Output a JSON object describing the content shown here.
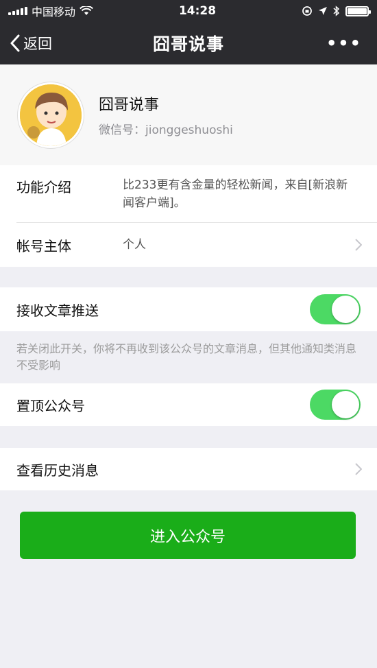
{
  "status_bar": {
    "carrier": "中国移动",
    "time": "14:28"
  },
  "nav": {
    "back_label": "返回",
    "title": "囧哥说事",
    "more_label": "•••"
  },
  "profile": {
    "name": "囧哥说事",
    "wechat_id": "微信号：jionggeshuoshi"
  },
  "info": {
    "intro_label": "功能介绍",
    "intro_value": "比233更有含金量的轻松新闻，来自[新浪新闻客户端]。",
    "owner_label": "帐号主体",
    "owner_value": "个人"
  },
  "settings": {
    "receive_label": "接收文章推送",
    "receive_on": true,
    "receive_hint": "若关闭此开关，你将不再收到该公众号的文章消息，但其他通知类消息不受影响",
    "pin_label": "置顶公众号",
    "pin_on": true,
    "history_label": "查看历史消息"
  },
  "enter_button": "进入公众号",
  "colors": {
    "nav_bg": "#2b2b2f",
    "toggle_on": "#4cd964",
    "primary_button": "#1aad19",
    "page_bg": "#efeff4"
  }
}
